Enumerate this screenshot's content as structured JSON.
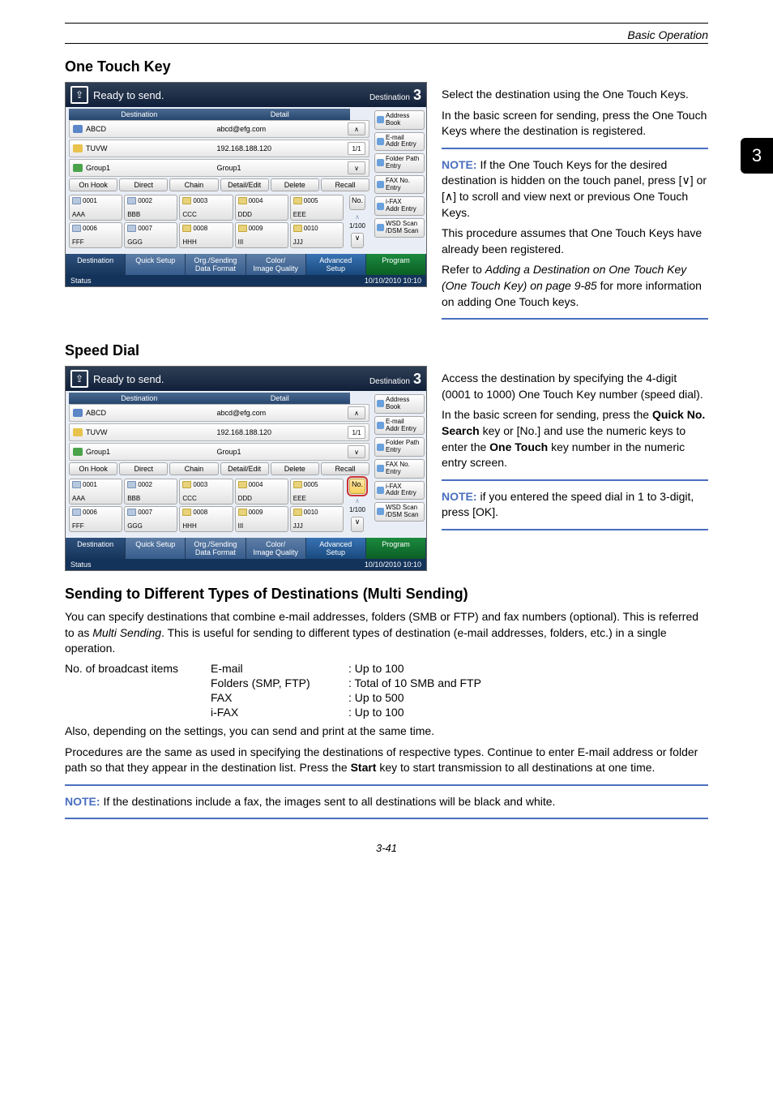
{
  "header": {
    "section": "Basic Operation"
  },
  "side_tab": "3",
  "page_number": "3-41",
  "one_touch": {
    "heading": "One Touch Key",
    "para_select": "Select the destination using the One Touch Keys.",
    "para_basic": "In the basic screen for sending, press the One Touch Keys where the destination is registered.",
    "note_a1": " If the One Touch Keys for the desired destination is hidden on the touch panel, press [∨] or [∧] to scroll and view next or previous One Touch Keys.",
    "note_a2": "This procedure assumes that One Touch Keys have already been registered.",
    "note_a3a": "Refer to ",
    "note_a3b_italic": "Adding a Destination on One Touch Key (One Touch Key) on page 9-85",
    "note_a3c": " for more information on adding One Touch keys."
  },
  "speed_dial": {
    "heading": "Speed Dial",
    "para_access": "Access the destination by specifying the 4-digit (0001 to 1000) One Touch Key number (speed dial).",
    "para_basic_a": "In the basic screen for sending, press the ",
    "para_basic_b_bold": "Quick No. Search",
    "para_basic_c": " key or [No.] and use the numeric keys to enter the ",
    "para_basic_d_bold": "One Touch",
    "para_basic_e": " key number in the numeric entry screen.",
    "note_a": " if you entered the speed dial in 1 to 3-digit, press [OK]."
  },
  "panel": {
    "title": "Ready to send.",
    "dest_label": "Destination",
    "dest_count": "3",
    "col_dest": "Destination",
    "col_detail": "Detail",
    "r1_name": "ABCD",
    "r1_detail": "abcd@efg.com",
    "r2_name": "TUVW",
    "r2_detail": "192.168.188.120",
    "r2_counter": "1/1",
    "r3_name": "Group1",
    "r3_detail": "Group1",
    "btns": {
      "onhook": "On Hook",
      "direct": "Direct",
      "chain": "Chain",
      "detailedit": "Detail/Edit",
      "delete": "Delete",
      "recall": "Recall"
    },
    "keys": [
      {
        "no": "0001",
        "label": "AAA",
        "type": "env"
      },
      {
        "no": "0002",
        "label": "BBB",
        "type": "env"
      },
      {
        "no": "0003",
        "label": "CCC",
        "type": "pc"
      },
      {
        "no": "0004",
        "label": "DDD",
        "type": "pc"
      },
      {
        "no": "0005",
        "label": "EEE",
        "type": "pc"
      },
      {
        "no": "0006",
        "label": "FFF",
        "type": "env"
      },
      {
        "no": "0007",
        "label": "GGG",
        "type": "env"
      },
      {
        "no": "0008",
        "label": "HHH",
        "type": "pc"
      },
      {
        "no": "0009",
        "label": "III",
        "type": "pc"
      },
      {
        "no": "0010",
        "label": "JJJ",
        "type": "pc"
      }
    ],
    "no_btn": "No.",
    "page_ind": "1/100",
    "side": {
      "addr_book": "Address\nBook",
      "email": "E-mail\nAddr Entry",
      "folder": "Folder Path\nEntry",
      "faxno": "FAX No.\nEntry",
      "ifax": "i-FAX\nAddr Entry",
      "wsd": "WSD Scan\n/DSM Scan"
    },
    "tabs": {
      "dest": "Destination",
      "quick": "Quick Setup",
      "org": "Org./Sending\nData Format",
      "color": "Color/\nImage Quality",
      "adv": "Advanced\nSetup",
      "prog": "Program"
    },
    "status": "Status",
    "timestamp": "10/10/2010  10:10"
  },
  "multi": {
    "heading": "Sending to Different Types of Destinations (Multi Sending)",
    "p1a": "You can specify destinations that combine e-mail addresses, folders (SMB or FTP) and fax numbers (optional). This is referred to as ",
    "p1b_italic": "Multi Sending",
    "p1c": ". This is useful for sending to different types of destination (e-mail addresses, folders, etc.) in a single operation.",
    "label": "No. of broadcast items",
    "rows": [
      {
        "k": "E-mail",
        "v": ": Up to 100"
      },
      {
        "k": "Folders (SMP, FTP)",
        "v": ": Total of 10 SMB and FTP"
      },
      {
        "k": "FAX",
        "v": ": Up to 500"
      },
      {
        "k": "i-FAX",
        "v": ": Up to 100"
      }
    ],
    "p2": "Also, depending on the settings, you can send and print at the same time.",
    "p3a": "Procedures are the same as used in specifying the destinations of respective types. Continue to enter E-mail address or folder path so that they appear in the destination list. Press the ",
    "p3b_bold": "Start",
    "p3c": " key to start transmission to all destinations at one time.",
    "note": " If the destinations include a fax, the images sent to all destinations will be black and white."
  },
  "note_label": "NOTE:"
}
